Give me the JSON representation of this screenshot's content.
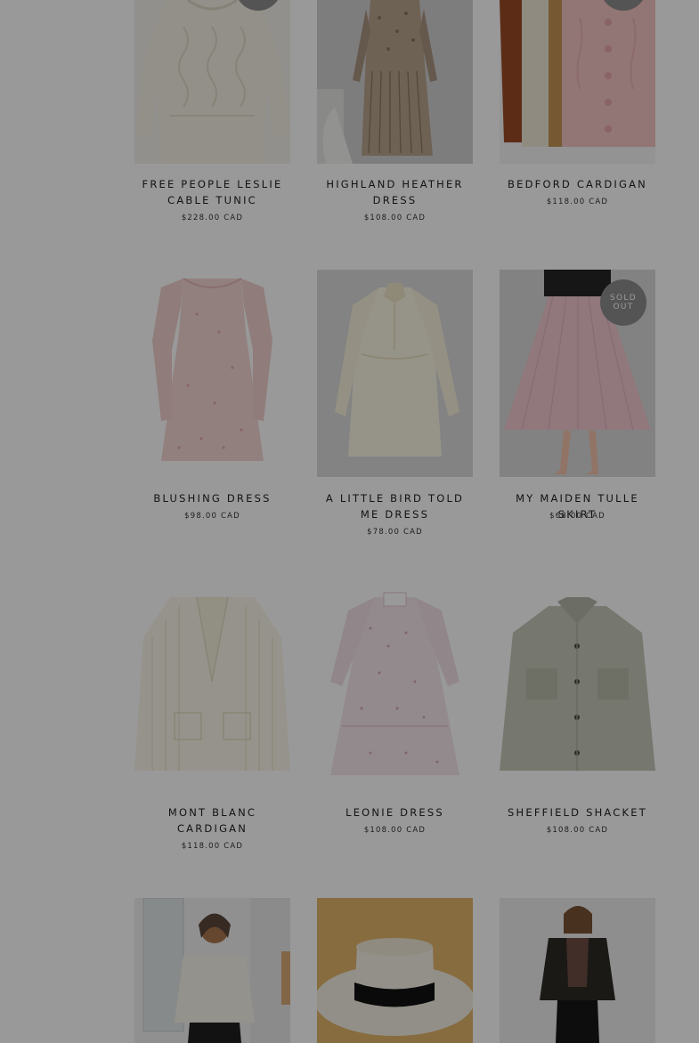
{
  "products": [
    {
      "title": "FREE PEOPLE LESLIE CABLE TUNIC",
      "price": "$228.00 CAD",
      "image": "cream-cable-tunic"
    },
    {
      "title": "HIGHLAND HEATHER DRESS",
      "price": "$108.00 CAD",
      "image": "floral-pleated-dress"
    },
    {
      "title": "BEDFORD CARDIGAN",
      "price": "$118.00 CAD",
      "image": "cardigans-stack"
    },
    {
      "title": "BLUSHING DRESS",
      "price": "$98.00 CAD",
      "image": "pink-floral-dress"
    },
    {
      "title": "A LITTLE BIRD TOLD ME DRESS",
      "price": "$78.00 CAD",
      "image": "cream-shirt-dress"
    },
    {
      "title": "MY MAIDEN TULLE SKIRT",
      "price": "$68.00 CAD",
      "image": "pink-tulle-skirt"
    },
    {
      "title": "MONT BLANC CARDIGAN",
      "price": "$118.00 CAD",
      "image": "cream-ribbed-cardigan"
    },
    {
      "title": "LEONIE DRESS",
      "price": "$108.00 CAD",
      "image": "dotted-tiered-dress"
    },
    {
      "title": "SHEFFIELD SHACKET",
      "price": "$108.00 CAD",
      "image": "sage-shacket"
    },
    {
      "title": "",
      "price": "",
      "image": "model-white-sweater"
    },
    {
      "title": "",
      "price": "",
      "image": "white-boater-hat"
    },
    {
      "title": "",
      "price": "",
      "image": "model-black-jacket"
    }
  ],
  "badge": {
    "sold_out_line1": "SOLD",
    "sold_out_line2": "OUT"
  },
  "colors": {
    "overlay": "#000000",
    "badge": "#8c8c8c",
    "text": "#222222"
  }
}
